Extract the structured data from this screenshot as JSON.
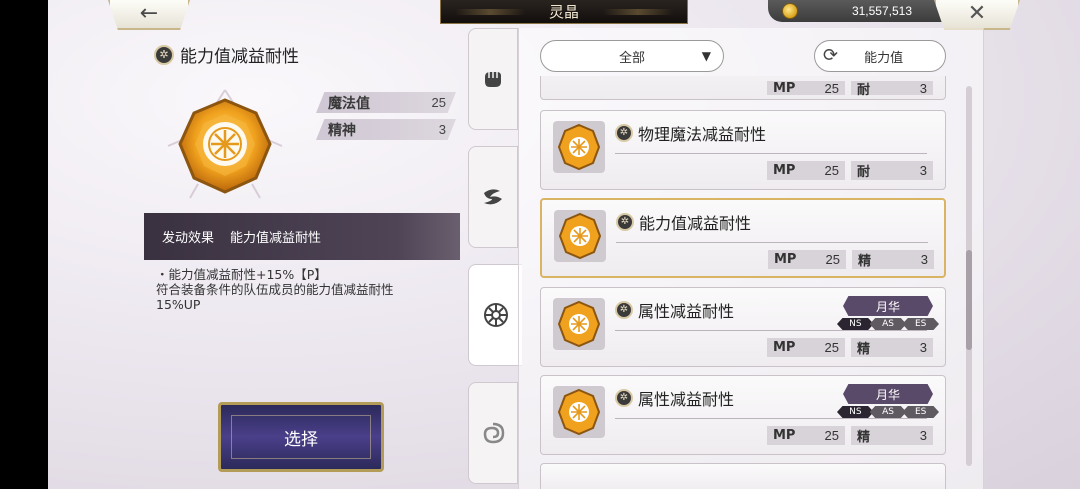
{
  "header": {
    "back_label": "←",
    "title": "灵晶",
    "coins": "31,557,513",
    "close_label": "✕"
  },
  "detail": {
    "name": "能力值减益耐性",
    "stats": [
      {
        "label": "魔法值",
        "value": "25"
      },
      {
        "label": "精神",
        "value": "3"
      }
    ],
    "effect_label": "发动效果",
    "effect_value": "能力值减益耐性",
    "description_line1": "・能力值减益耐性+15%【P】",
    "description_line2": "符合装备条件的队伍成员的能力值减益耐性",
    "description_line3": "15%UP",
    "select_label": "选择"
  },
  "toolbar": {
    "filter_value": "全部",
    "filter_arrow": "▼",
    "sort_label": "能力值"
  },
  "items": [
    {
      "name": "物理魔法减益耐性",
      "mp_label": "MP",
      "mp": "25",
      "stat_label": "耐",
      "stat": "3"
    },
    {
      "name": "能力值减益耐性",
      "mp_label": "MP",
      "mp": "25",
      "stat_label": "精",
      "stat": "3"
    },
    {
      "name": "属性减益耐性",
      "mp_label": "MP",
      "mp": "25",
      "stat_label": "精",
      "stat": "3",
      "tag": "月华",
      "phases": [
        "NS",
        "AS",
        "ES"
      ]
    },
    {
      "name": "属性减益耐性",
      "mp_label": "MP",
      "mp": "25",
      "stat_label": "精",
      "stat": "3",
      "tag": "月华",
      "phases": [
        "NS",
        "AS",
        "ES"
      ]
    }
  ],
  "partial_item": {
    "mp_label": "MP",
    "mp": "25",
    "stat_label": "耐",
    "stat": "3"
  },
  "colors": {
    "accent_gold": "#d9b463",
    "gem_orange": "#f0a21e",
    "panel_dark": "#3a3140"
  },
  "icons": [
    "back-arrow-icon",
    "coin-icon",
    "close-icon",
    "fist-icon",
    "wind-swirl-icon",
    "crystal-emblem-icon",
    "spiral-icon",
    "refresh-icon",
    "chevron-down-icon"
  ]
}
